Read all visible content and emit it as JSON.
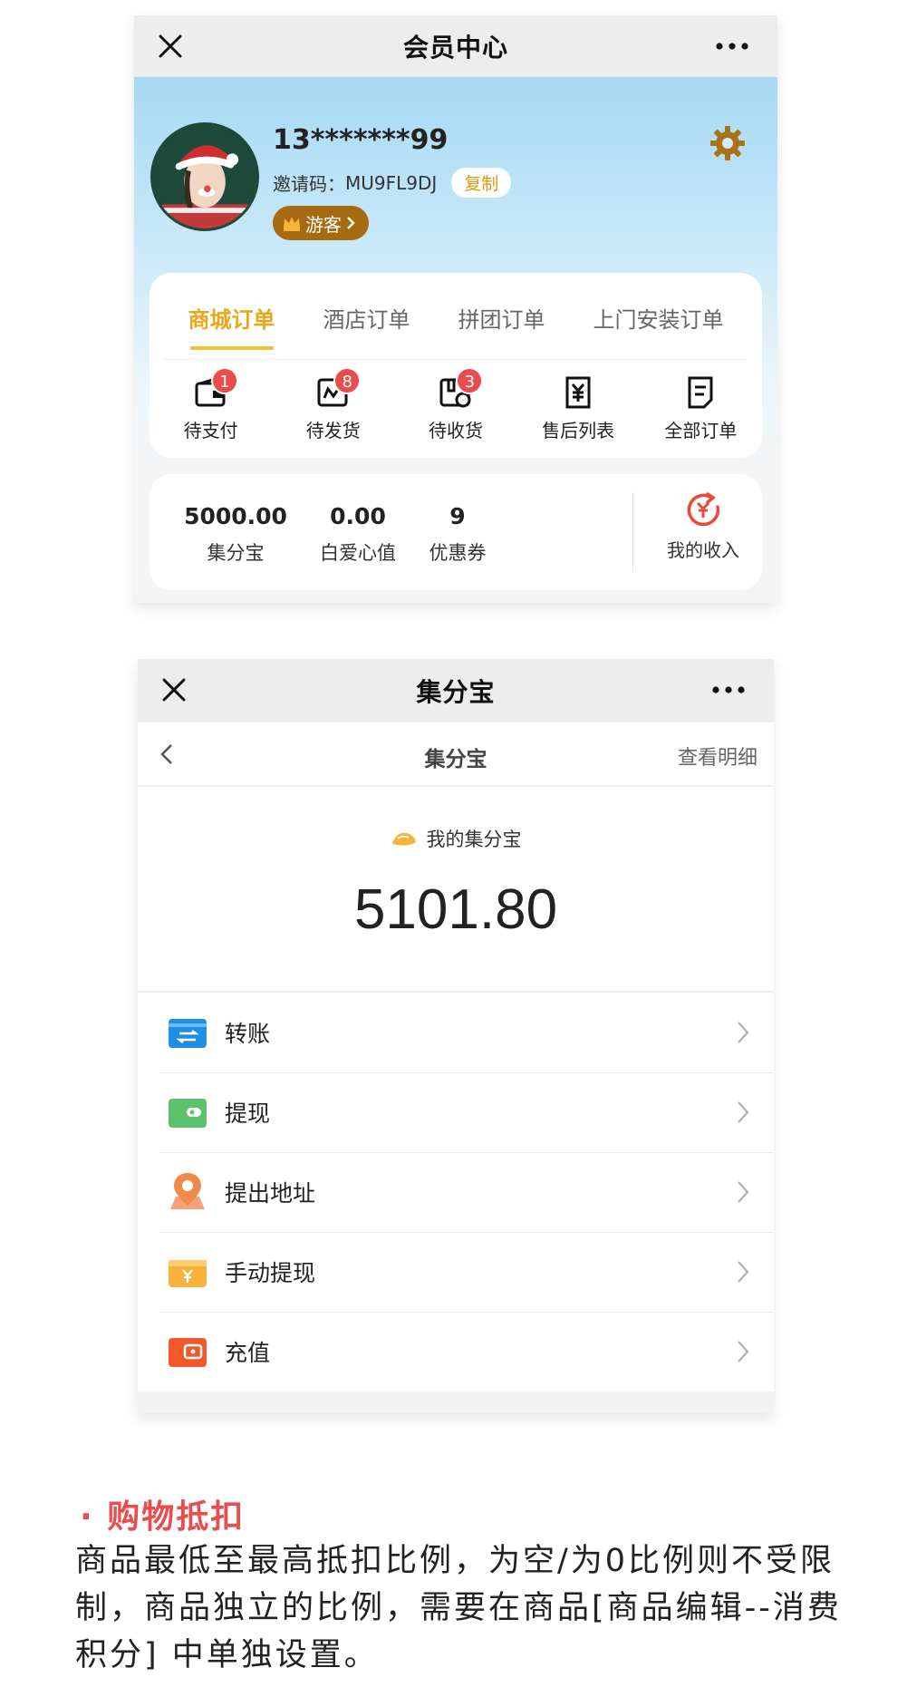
{
  "member_center": {
    "title": "会员中心",
    "user": {
      "phone": "13*******99",
      "invite_label": "邀请码：",
      "invite_code": "MU9FL9DJ",
      "copy_label": "复制",
      "level": "游客"
    },
    "order_tabs": [
      "商城订单",
      "酒店订单",
      "拼团订单",
      "上门安装订单"
    ],
    "active_tab": "商城订单",
    "order_icons": [
      {
        "label": "待支付",
        "badge": "1",
        "icon": "wallet-icon"
      },
      {
        "label": "待发货",
        "badge": "8",
        "icon": "ship-box-icon"
      },
      {
        "label": "待收货",
        "badge": "3",
        "icon": "receive-box-icon"
      },
      {
        "label": "售后列表",
        "badge": "",
        "icon": "yuan-refund-icon"
      },
      {
        "label": "全部订单",
        "badge": "",
        "icon": "document-icon"
      }
    ],
    "stats": [
      {
        "value": "5000.00",
        "label": "集分宝"
      },
      {
        "value": "0.00",
        "label": "白爱心值"
      },
      {
        "value": "9",
        "label": "优惠券"
      }
    ],
    "income_label": "我的收入",
    "accent_color": "#e9a81a"
  },
  "jifenbao": {
    "window_title": "集分宝",
    "nav_title": "集分宝",
    "detail_link": "查看明细",
    "caption": "我的集分宝",
    "amount": "5101.80",
    "menu": [
      {
        "label": "转账",
        "icon": "transfer-icon",
        "color": "#1f8fe6"
      },
      {
        "label": "提现",
        "icon": "withdraw-wallet-icon",
        "color": "#5cc26b"
      },
      {
        "label": "提出地址",
        "icon": "location-pin-icon",
        "color": "#f08a4b"
      },
      {
        "label": "手动提现",
        "icon": "manual-withdraw-icon",
        "color": "#f6b23a"
      },
      {
        "label": "充值",
        "icon": "recharge-icon",
        "color": "#f05a2a"
      }
    ]
  },
  "doc": {
    "section_title": "· 购物抵扣",
    "paragraph": "商品最低至最高抵扣比例，为空/为0比例则不受限制，商品独立的比例，需要在商品[商品编辑--消费积分] 中单独设置。"
  }
}
